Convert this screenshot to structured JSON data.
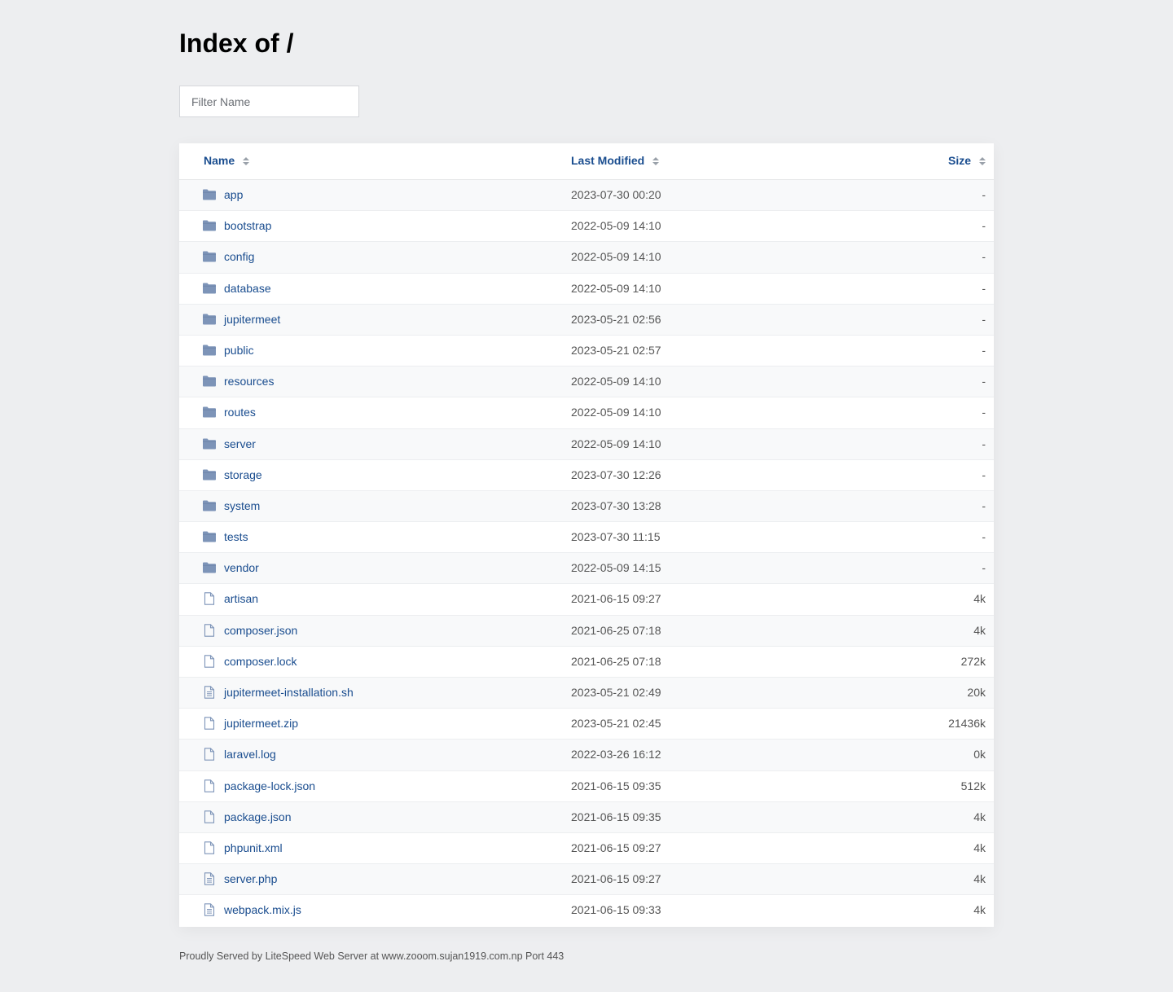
{
  "page": {
    "title": "Index of /",
    "filter_placeholder": "Filter Name",
    "footer": "Proudly Served by LiteSpeed Web Server at www.zooom.sujan1919.com.np Port 443"
  },
  "columns": {
    "name": "Name",
    "last_modified": "Last Modified",
    "size": "Size"
  },
  "colors": {
    "link": "#1a4d8f",
    "folder_icon": "#7d94b8",
    "background": "#edeef0"
  },
  "rows": [
    {
      "name": "app",
      "modified": "2023-07-30 00:20",
      "size": "-",
      "icon": "folder-icon"
    },
    {
      "name": "bootstrap",
      "modified": "2022-05-09 14:10",
      "size": "-",
      "icon": "folder-icon"
    },
    {
      "name": "config",
      "modified": "2022-05-09 14:10",
      "size": "-",
      "icon": "folder-icon"
    },
    {
      "name": "database",
      "modified": "2022-05-09 14:10",
      "size": "-",
      "icon": "folder-icon"
    },
    {
      "name": "jupitermeet",
      "modified": "2023-05-21 02:56",
      "size": "-",
      "icon": "folder-icon"
    },
    {
      "name": "public",
      "modified": "2023-05-21 02:57",
      "size": "-",
      "icon": "folder-icon"
    },
    {
      "name": "resources",
      "modified": "2022-05-09 14:10",
      "size": "-",
      "icon": "folder-icon"
    },
    {
      "name": "routes",
      "modified": "2022-05-09 14:10",
      "size": "-",
      "icon": "folder-icon"
    },
    {
      "name": "server",
      "modified": "2022-05-09 14:10",
      "size": "-",
      "icon": "folder-icon"
    },
    {
      "name": "storage",
      "modified": "2023-07-30 12:26",
      "size": "-",
      "icon": "folder-icon"
    },
    {
      "name": "system",
      "modified": "2023-07-30 13:28",
      "size": "-",
      "icon": "folder-icon"
    },
    {
      "name": "tests",
      "modified": "2023-07-30 11:15",
      "size": "-",
      "icon": "folder-icon"
    },
    {
      "name": "vendor",
      "modified": "2022-05-09 14:15",
      "size": "-",
      "icon": "folder-icon"
    },
    {
      "name": "artisan",
      "modified": "2021-06-15 09:27",
      "size": "4k",
      "icon": "file-icon"
    },
    {
      "name": "composer.json",
      "modified": "2021-06-25 07:18",
      "size": "4k",
      "icon": "file-icon"
    },
    {
      "name": "composer.lock",
      "modified": "2021-06-25 07:18",
      "size": "272k",
      "icon": "file-icon"
    },
    {
      "name": "jupitermeet-installation.sh",
      "modified": "2023-05-21 02:49",
      "size": "20k",
      "icon": "text-file-icon"
    },
    {
      "name": "jupitermeet.zip",
      "modified": "2023-05-21 02:45",
      "size": "21436k",
      "icon": "file-icon"
    },
    {
      "name": "laravel.log",
      "modified": "2022-03-26 16:12",
      "size": "0k",
      "icon": "file-icon"
    },
    {
      "name": "package-lock.json",
      "modified": "2021-06-15 09:35",
      "size": "512k",
      "icon": "file-icon"
    },
    {
      "name": "package.json",
      "modified": "2021-06-15 09:35",
      "size": "4k",
      "icon": "file-icon"
    },
    {
      "name": "phpunit.xml",
      "modified": "2021-06-15 09:27",
      "size": "4k",
      "icon": "file-icon"
    },
    {
      "name": "server.php",
      "modified": "2021-06-15 09:27",
      "size": "4k",
      "icon": "text-file-icon"
    },
    {
      "name": "webpack.mix.js",
      "modified": "2021-06-15 09:33",
      "size": "4k",
      "icon": "text-file-icon"
    }
  ]
}
